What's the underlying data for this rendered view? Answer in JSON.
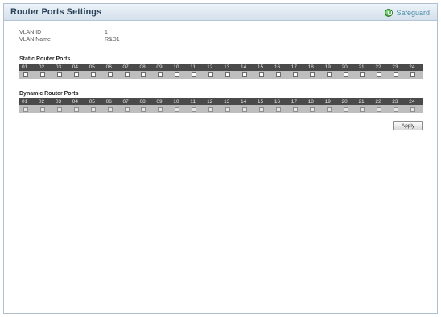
{
  "header": {
    "title": "Router Ports Settings",
    "safeguard_label": "Safeguard"
  },
  "vlan": {
    "id_label": "VLAN ID",
    "id_value": "1",
    "name_label": "VLAN Name",
    "name_value": "R&D1"
  },
  "static_ports": {
    "title": "Static Router Ports",
    "ports": [
      "01",
      "02",
      "03",
      "04",
      "05",
      "06",
      "07",
      "08",
      "09",
      "10",
      "11",
      "12",
      "13",
      "14",
      "15",
      "16",
      "17",
      "18",
      "19",
      "20",
      "21",
      "22",
      "23",
      "24"
    ]
  },
  "dynamic_ports": {
    "title": "Dynamic Router Ports",
    "ports": [
      "01",
      "02",
      "03",
      "04",
      "05",
      "06",
      "07",
      "08",
      "09",
      "10",
      "11",
      "12",
      "13",
      "14",
      "15",
      "16",
      "17",
      "18",
      "19",
      "20",
      "21",
      "22",
      "23",
      "24"
    ]
  },
  "actions": {
    "apply_label": "Apply"
  }
}
